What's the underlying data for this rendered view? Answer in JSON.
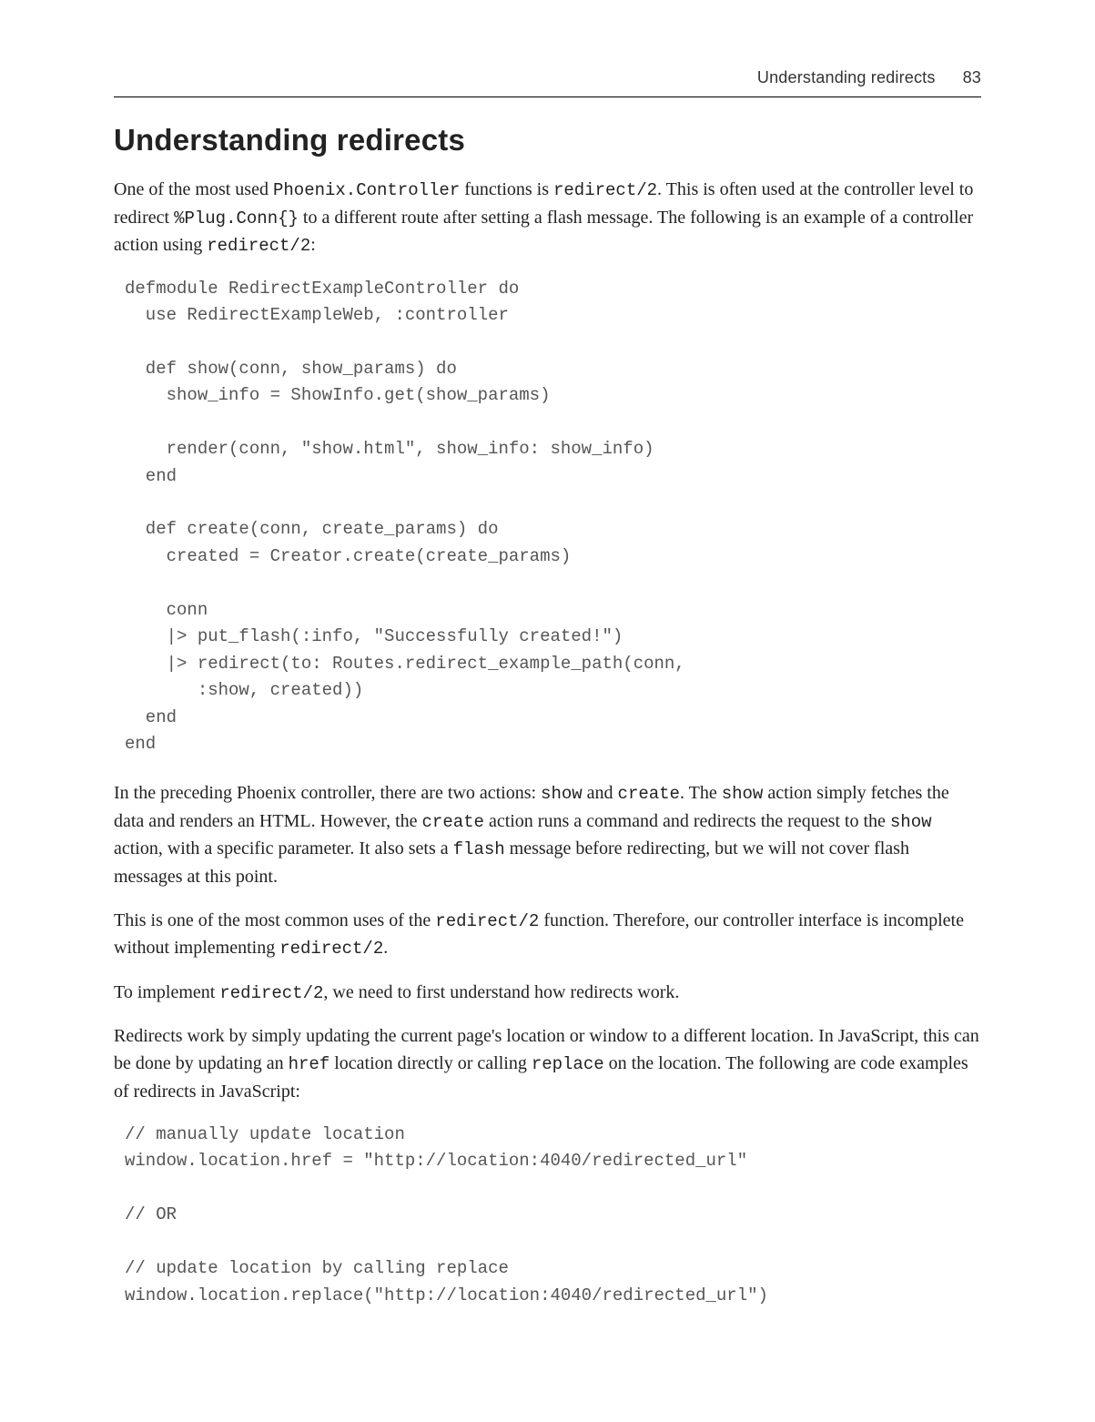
{
  "header": {
    "running_title": "Understanding redirects",
    "page_number": "83"
  },
  "title": "Understanding redirects",
  "para1_open": "One of the most used ",
  "code1": "Phoenix.Controller",
  "para1_mid1": " functions is ",
  "code2": "redirect/2",
  "para1_mid2": ". This is often used at the controller level to redirect ",
  "code3": "%Plug.Conn{}",
  "para1_mid3": " to a different route after setting a flash message. The following is an example of a controller action using ",
  "code4": "redirect/2",
  "para1_end": ":",
  "codeblock1": "defmodule RedirectExampleController do\n  use RedirectExampleWeb, :controller\n\n  def show(conn, show_params) do\n    show_info = ShowInfo.get(show_params)\n\n    render(conn, \"show.html\", show_info: show_info)\n  end\n\n  def create(conn, create_params) do\n    created = Creator.create(create_params)\n\n    conn\n    |> put_flash(:info, \"Successfully created!\")\n    |> redirect(to: Routes.redirect_example_path(conn,\n       :show, created))\n  end\nend",
  "para2_open": "In the preceding Phoenix controller, there are two actions: ",
  "code5": "show",
  "para2_mid1": " and ",
  "code6": "create",
  "para2_mid2": ". The ",
  "code7": "show",
  "para2_mid3": " action simply fetches the data and renders an HTML. However, the ",
  "code8": "create",
  "para2_mid4": " action runs a command and redirects the request to the ",
  "code9": "show",
  "para2_mid5": " action, with a specific parameter. It also sets a ",
  "code10": "flash",
  "para2_end": " message before redirecting, but we will not cover flash messages at this point.",
  "para3_open": "This is one of the most common uses of the ",
  "code11": "redirect/2",
  "para3_mid": " function. Therefore, our controller interface is incomplete without implementing ",
  "code12": "redirect/2",
  "para3_end": ".",
  "para4_open": "To implement ",
  "code13": "redirect/2",
  "para4_end": ", we need to first understand how redirects work.",
  "para5_open": "Redirects work by simply updating the current page's location or window to a different location. In JavaScript, this can be done by updating an ",
  "code14": "href",
  "para5_mid1": " location directly or calling ",
  "code15": "replace",
  "para5_end": " on the location. The following are code examples of redirects in JavaScript:",
  "codeblock2": "// manually update location\nwindow.location.href = \"http://location:4040/redirected_url\"\n\n// OR\n\n// update location by calling replace\nwindow.location.replace(\"http://location:4040/redirected_url\")"
}
